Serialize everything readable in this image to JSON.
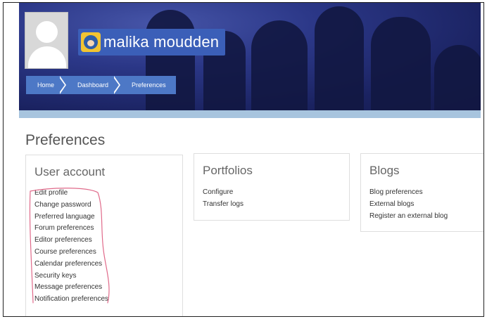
{
  "header": {
    "user_name": "malika moudden",
    "breadcrumb": [
      "Home",
      "Dashboard",
      "Preferences"
    ]
  },
  "page": {
    "title": "Preferences"
  },
  "cards": {
    "user_account": {
      "title": "User account",
      "links": [
        "Edit profile",
        "Change password",
        "Preferred language",
        "Forum preferences",
        "Editor preferences",
        "Course preferences",
        "Calendar preferences",
        "Security keys",
        "Message preferences",
        "Notification preferences"
      ]
    },
    "portfolios": {
      "title": "Portfolios",
      "links": [
        "Configure",
        "Transfer logs"
      ]
    },
    "blogs": {
      "title": "Blogs",
      "links": [
        "Blog preferences",
        "External blogs",
        "Register an external blog"
      ]
    }
  },
  "colors": {
    "banner": "#1f2a6a",
    "breadcrumb": "#4d78c6",
    "name_box": "#3b5fb8",
    "strip": "#a7c4de",
    "annotation": "#e06a8a"
  }
}
